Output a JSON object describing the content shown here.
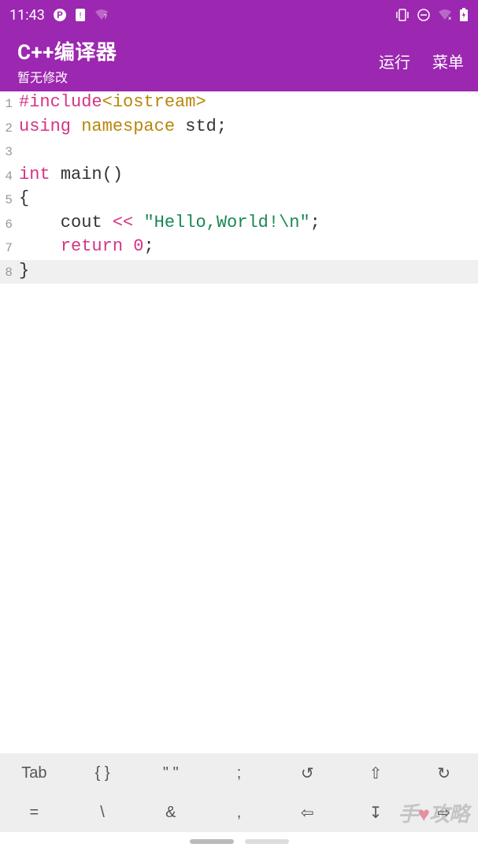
{
  "status_bar": {
    "time": "11:43"
  },
  "app_bar": {
    "title": "C++编译器",
    "subtitle": "暂无修改",
    "run_label": "运行",
    "menu_label": "菜单"
  },
  "code": {
    "lines": [
      {
        "num": "1",
        "tokens": [
          {
            "t": "#include",
            "c": "tok-preproc"
          },
          {
            "t": "<iostream>",
            "c": "tok-include"
          }
        ]
      },
      {
        "num": "2",
        "tokens": [
          {
            "t": "using",
            "c": "tok-preproc"
          },
          {
            "t": " ",
            "c": "tok-plain"
          },
          {
            "t": "namespace",
            "c": "tok-func"
          },
          {
            "t": " ",
            "c": "tok-plain"
          },
          {
            "t": "std",
            "c": "tok-plain"
          },
          {
            "t": ";",
            "c": "tok-punct"
          }
        ]
      },
      {
        "num": "3",
        "tokens": []
      },
      {
        "num": "4",
        "tokens": [
          {
            "t": "int",
            "c": "tok-preproc"
          },
          {
            "t": " ",
            "c": "tok-plain"
          },
          {
            "t": "main",
            "c": "tok-plain"
          },
          {
            "t": "()",
            "c": "tok-plain"
          }
        ]
      },
      {
        "num": "5",
        "tokens": [
          {
            "t": "{",
            "c": "tok-plain"
          }
        ]
      },
      {
        "num": "6",
        "tokens": [
          {
            "t": "    cout ",
            "c": "tok-plain"
          },
          {
            "t": "<<",
            "c": "tok-preproc"
          },
          {
            "t": " ",
            "c": "tok-plain"
          },
          {
            "t": "\"Hello,World!\\n\"",
            "c": "tok-string"
          },
          {
            "t": ";",
            "c": "tok-punct"
          }
        ]
      },
      {
        "num": "7",
        "tokens": [
          {
            "t": "    ",
            "c": "tok-plain"
          },
          {
            "t": "return",
            "c": "tok-preproc"
          },
          {
            "t": " ",
            "c": "tok-plain"
          },
          {
            "t": "0",
            "c": "tok-number"
          },
          {
            "t": ";",
            "c": "tok-punct"
          }
        ]
      },
      {
        "num": "8",
        "highlight": true,
        "tokens": [
          {
            "t": "}",
            "c": "tok-plain"
          }
        ]
      }
    ]
  },
  "symbol_bar": {
    "row1": [
      "Tab",
      "{ }",
      "\" \"",
      ";",
      "↺",
      "⇧",
      "↻"
    ],
    "row2": [
      "=",
      "\\",
      "&",
      ",",
      "⇦",
      "↧",
      "⇨"
    ]
  },
  "watermark": {
    "prefix": "手",
    "heart": "♥",
    "suffix": "攻略"
  }
}
